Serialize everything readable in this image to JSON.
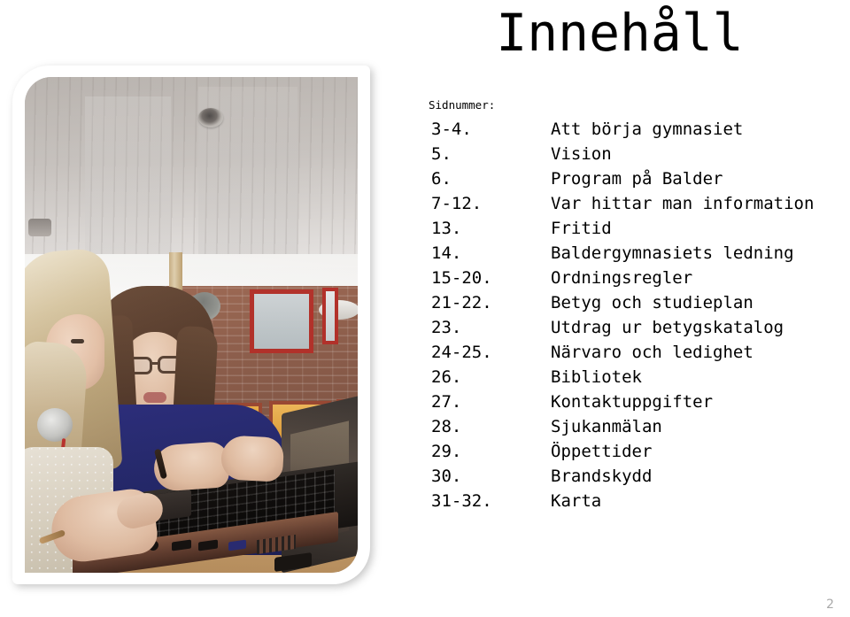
{
  "slide": {
    "title": "Innehåll",
    "page_number": "2",
    "background_color": "#ffffff",
    "text_color": "#000000",
    "page_number_color": "#a9a9a9"
  },
  "photo": {
    "alt_name": "two-students-with-laptop-photo",
    "frame_style": "rounded-diagonal-corner-white",
    "frame_color": "#ffffff"
  },
  "toc": {
    "caption": "Sidnummer:",
    "entries": [
      {
        "pages": "3-4.",
        "label": "Att börja gymnasiet"
      },
      {
        "pages": "5.",
        "label": "Vision"
      },
      {
        "pages": "6.",
        "label": "Program på Balder"
      },
      {
        "pages": "7-12.",
        "label": "Var hittar man information"
      },
      {
        "pages": "13.",
        "label": "Fritid"
      },
      {
        "pages": "14.",
        "label": "Baldergymnasiets ledning"
      },
      {
        "pages": "15-20.",
        "label": "Ordningsregler"
      },
      {
        "pages": "21-22.",
        "label": "Betyg och studieplan"
      },
      {
        "pages": "23.",
        "label": "Utdrag ur betygskatalog"
      },
      {
        "pages": "24-25.",
        "label": "Närvaro och ledighet"
      },
      {
        "pages": "26.",
        "label": "Bibliotek"
      },
      {
        "pages": "27.",
        "label": "Kontaktuppgifter"
      },
      {
        "pages": "28.",
        "label": "Sjukanmälan"
      },
      {
        "pages": "29.",
        "label": "Öppettider"
      },
      {
        "pages": "30.",
        "label": "Brandskydd"
      },
      {
        "pages": "31-32.",
        "label": "Karta"
      }
    ]
  }
}
